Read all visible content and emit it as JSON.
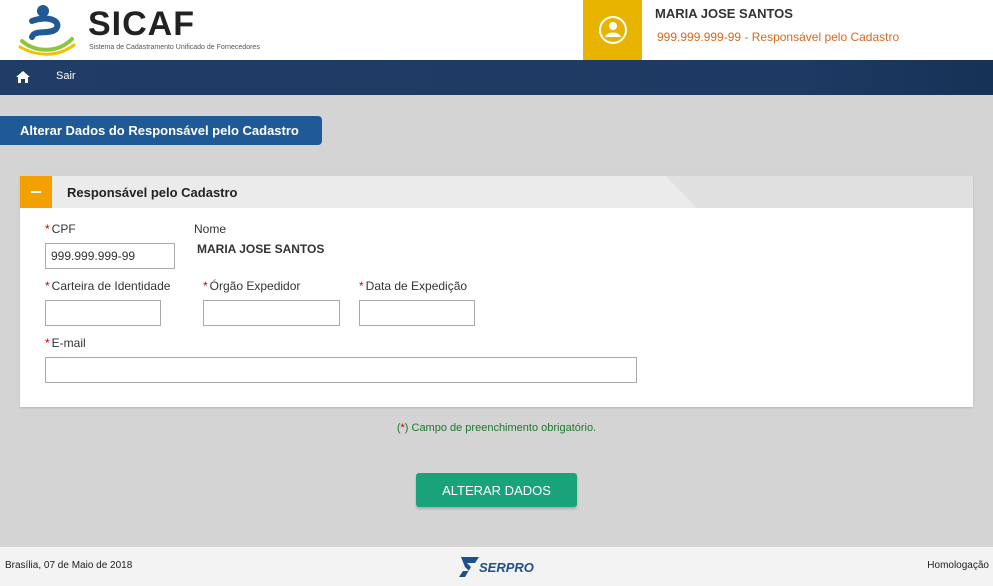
{
  "header": {
    "logo_title": "SICAF",
    "logo_subtitle": "Sistema de Cadastramento Unificado de Fornecedores",
    "user_name": "MARIA JOSE SANTOS",
    "user_role": "999.999.999-99 - Responsável pelo Cadastro"
  },
  "nav": {
    "home_icon": "home-icon",
    "exit_label": "Sair"
  },
  "page": {
    "title": "Alterar Dados do Responsável pelo Cadastro"
  },
  "panel": {
    "title": "Responsável pelo Cadastro",
    "collapse_icon": "minus-icon",
    "fields": {
      "cpf": {
        "label": "CPF",
        "value": "999.999.999-99",
        "required": true
      },
      "nome": {
        "label": "Nome",
        "value": "MARIA JOSE SANTOS"
      },
      "carteira": {
        "label": "Carteira de Identidade",
        "value": "",
        "required": true
      },
      "orgao": {
        "label": "Órgão Expedidor",
        "value": "",
        "required": true
      },
      "data": {
        "label": "Data de Expedição",
        "value": "",
        "required": true
      },
      "email": {
        "label": "E-mail",
        "value": "",
        "required": true
      }
    },
    "required_marker": "*"
  },
  "required_note": {
    "open": "(",
    "star": "*",
    "text": ") Campo de preenchimento obrigatório."
  },
  "actions": {
    "submit_label": "ALTERAR DADOS"
  },
  "footer": {
    "date": "Brasília, 07 de Maio de 2018",
    "logo_text": "SERPRO",
    "environment": "Homologação"
  },
  "colors": {
    "navbar": "#1f3d66",
    "tab": "#1f5a96",
    "avatar_bg": "#e8b400",
    "collapse_bg": "#f2a100",
    "submit_bg": "#1aa37a",
    "role_text": "#d8691d",
    "required_star": "#cc0000"
  }
}
